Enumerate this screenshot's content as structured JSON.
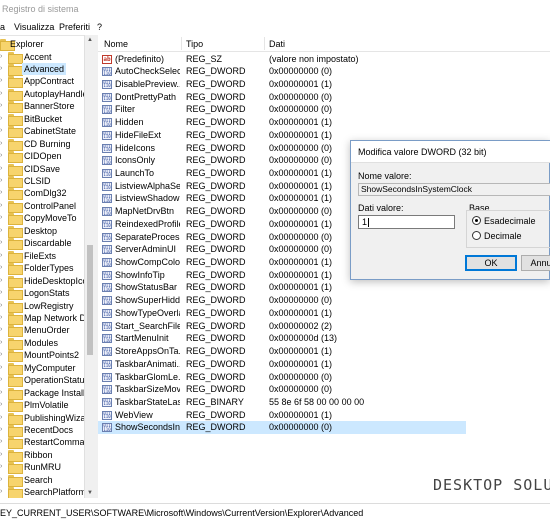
{
  "window": {
    "title": "Registro di sistema"
  },
  "menu": {
    "items": [
      "a",
      "Visualizza",
      "Preferiti",
      "?"
    ]
  },
  "tree": {
    "root": "Explorer",
    "items": [
      "Accent",
      "Advanced",
      "AppContract",
      "AutoplayHandle",
      "BannerStore",
      "BitBucket",
      "CabinetState",
      "CD Burning",
      "CIDOpen",
      "CIDSave",
      "CLSID",
      "ComDlg32",
      "ControlPanel",
      "CopyMoveTo",
      "Desktop",
      "Discardable",
      "FileExts",
      "FolderTypes",
      "HideDesktopIco",
      "LogonStats",
      "LowRegistry",
      "Map Network D",
      "MenuOrder",
      "Modules",
      "MountPoints2",
      "MyComputer",
      "OperationStatus",
      "Package Installa",
      "PlmVolatile",
      "PublishingWizar",
      "RecentDocs",
      "RestartComman",
      "Ribbon",
      "RunMRU",
      "Search",
      "SearchPlatform"
    ],
    "selected": "Advanced"
  },
  "list": {
    "headers": {
      "name": "Nome",
      "type": "Tipo",
      "data": "Dati"
    },
    "rows": [
      {
        "name": "(Predefinito)",
        "type": "REG_SZ",
        "data": "(valore non impostato)",
        "icon": "ab"
      },
      {
        "name": "AutoCheckSelect",
        "type": "REG_DWORD",
        "data": "0x00000000 (0)",
        "icon": "bin"
      },
      {
        "name": "DisablePreview...",
        "type": "REG_DWORD",
        "data": "0x00000001 (1)",
        "icon": "bin"
      },
      {
        "name": "DontPrettyPath",
        "type": "REG_DWORD",
        "data": "0x00000000 (0)",
        "icon": "bin"
      },
      {
        "name": "Filter",
        "type": "REG_DWORD",
        "data": "0x00000000 (0)",
        "icon": "bin"
      },
      {
        "name": "Hidden",
        "type": "REG_DWORD",
        "data": "0x00000001 (1)",
        "icon": "bin"
      },
      {
        "name": "HideFileExt",
        "type": "REG_DWORD",
        "data": "0x00000001 (1)",
        "icon": "bin"
      },
      {
        "name": "HideIcons",
        "type": "REG_DWORD",
        "data": "0x00000000 (0)",
        "icon": "bin"
      },
      {
        "name": "IconsOnly",
        "type": "REG_DWORD",
        "data": "0x00000000 (0)",
        "icon": "bin"
      },
      {
        "name": "LaunchTo",
        "type": "REG_DWORD",
        "data": "0x00000001 (1)",
        "icon": "bin"
      },
      {
        "name": "ListviewAlphaSe...",
        "type": "REG_DWORD",
        "data": "0x00000001 (1)",
        "icon": "bin"
      },
      {
        "name": "ListviewShadow",
        "type": "REG_DWORD",
        "data": "0x00000001 (1)",
        "icon": "bin"
      },
      {
        "name": "MapNetDrvBtn",
        "type": "REG_DWORD",
        "data": "0x00000000 (0)",
        "icon": "bin"
      },
      {
        "name": "ReindexedProfile",
        "type": "REG_DWORD",
        "data": "0x00000001 (1)",
        "icon": "bin"
      },
      {
        "name": "SeparateProcess",
        "type": "REG_DWORD",
        "data": "0x00000000 (0)",
        "icon": "bin"
      },
      {
        "name": "ServerAdminUI",
        "type": "REG_DWORD",
        "data": "0x00000000 (0)",
        "icon": "bin"
      },
      {
        "name": "ShowCompColor",
        "type": "REG_DWORD",
        "data": "0x00000001 (1)",
        "icon": "bin"
      },
      {
        "name": "ShowInfoTip",
        "type": "REG_DWORD",
        "data": "0x00000001 (1)",
        "icon": "bin"
      },
      {
        "name": "ShowStatusBar",
        "type": "REG_DWORD",
        "data": "0x00000001 (1)",
        "icon": "bin"
      },
      {
        "name": "ShowSuperHidd...",
        "type": "REG_DWORD",
        "data": "0x00000000 (0)",
        "icon": "bin"
      },
      {
        "name": "ShowTypeOverlay",
        "type": "REG_DWORD",
        "data": "0x00000001 (1)",
        "icon": "bin"
      },
      {
        "name": "Start_SearchFiles",
        "type": "REG_DWORD",
        "data": "0x00000002 (2)",
        "icon": "bin"
      },
      {
        "name": "StartMenuInit",
        "type": "REG_DWORD",
        "data": "0x0000000d (13)",
        "icon": "bin"
      },
      {
        "name": "StoreAppsOnTa...",
        "type": "REG_DWORD",
        "data": "0x00000001 (1)",
        "icon": "bin"
      },
      {
        "name": "TaskbarAnimati...",
        "type": "REG_DWORD",
        "data": "0x00000001 (1)",
        "icon": "bin"
      },
      {
        "name": "TaskbarGlomLe...",
        "type": "REG_DWORD",
        "data": "0x00000000 (0)",
        "icon": "bin"
      },
      {
        "name": "TaskbarSizeMove",
        "type": "REG_DWORD",
        "data": "0x00000000 (0)",
        "icon": "bin"
      },
      {
        "name": "TaskbarStateLas...",
        "type": "REG_BINARY",
        "data": "55 8e 6f 58 00 00 00 00",
        "icon": "bin"
      },
      {
        "name": "WebView",
        "type": "REG_DWORD",
        "data": "0x00000001 (1)",
        "icon": "bin"
      },
      {
        "name": "ShowSecondsIn...",
        "type": "REG_DWORD",
        "data": "0x00000000 (0)",
        "icon": "bin",
        "selected": true
      }
    ]
  },
  "dialog": {
    "title": "Modifica valore DWORD (32 bit)",
    "name_label": "Nome valore:",
    "name_value": "ShowSecondsInSystemClock",
    "data_label": "Dati valore:",
    "data_value": "1",
    "base_label": "Base",
    "radio_hex": "Esadecimale",
    "radio_dec": "Decimale",
    "base_selected": "hex",
    "ok_label": "OK",
    "cancel_label": "Annu"
  },
  "status": {
    "path": "EY_CURRENT_USER\\SOFTWARE\\Microsoft\\Windows\\CurrentVersion\\Explorer\\Advanced"
  },
  "watermark": "DESKTOP SOLU"
}
